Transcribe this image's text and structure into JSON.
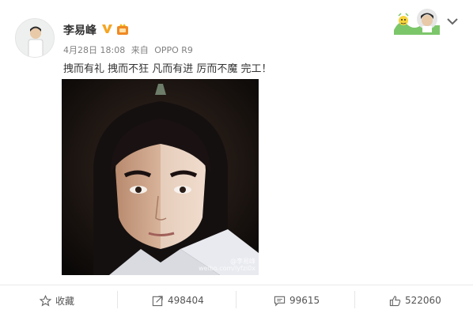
{
  "post": {
    "username": "李易峰",
    "timestamp": "4月28日 18:08",
    "source_prefix": "来自",
    "source": "OPPO R9",
    "text": "拽而有礼 拽而不狂 凡而有进 厉而不魔 完工！",
    "watermark_line1": "@李易峰",
    "watermark_line2": "weibo.com/lyfzi0x"
  },
  "badges": {
    "verified_icon": "verified-v-icon",
    "rank_icon": "rank-badge-icon"
  },
  "actions": {
    "favorite_label": "收藏",
    "favorite_icon": "star-icon",
    "repost_count": "498404",
    "repost_icon": "repost-icon",
    "comment_count": "99615",
    "comment_icon": "comment-icon",
    "like_count": "522060",
    "like_icon": "thumbs-up-icon"
  },
  "colors": {
    "verified": "#f5a623",
    "text": "#333333",
    "meta": "#808080",
    "icon": "#666666"
  }
}
